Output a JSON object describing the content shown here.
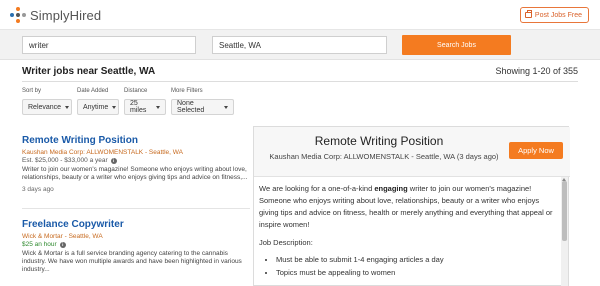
{
  "header": {
    "logo_text": "SimplyHired",
    "post_jobs_label": "Post Jobs Free",
    "brand_colors": [
      "#f47b20",
      "#2a6fb0",
      "#999999"
    ]
  },
  "search": {
    "what_value": "writer",
    "where_value": "Seattle, WA",
    "button_label": "Search Jobs"
  },
  "results": {
    "title": "Writer jobs near Seattle, WA",
    "showing": "Showing 1-20 of 355"
  },
  "filters": [
    {
      "label": "Sort by",
      "value": "Relevance"
    },
    {
      "label": "Date Added",
      "value": "Anytime"
    },
    {
      "label": "Distance",
      "value": "25 miles"
    },
    {
      "label": "More Filters",
      "value": "None Selected"
    }
  ],
  "jobs": [
    {
      "title": "Remote Writing Position",
      "company": "Kaushan Media Corp: ALLWOMENSTALK - Seattle, WA",
      "salary": "Est. $25,000 - $33,000 a year",
      "description": "Writer to join our women's magazine! Someone who enjoys writing about love, relationships, beauty or a writer who enjoys giving tips and advice on fitness,...",
      "age": "3 days ago"
    },
    {
      "title": "Freelance Copywriter",
      "company": "Wick & Mortar - Seattle, WA",
      "salary": "$25 an hour",
      "description": "Wick & Mortar is a full service branding agency catering to the cannabis industry. We have won multiple awards and have been highlighted in various industry...",
      "age": ""
    }
  ],
  "detail": {
    "title": "Remote Writing Position",
    "subtitle": "Kaushan Media Corp: ALLWOMENSTALK - Seattle, WA (3 days ago)",
    "apply_label": "Apply Now",
    "intro_before": "We are looking for a one-of-a-kind ",
    "intro_bold": "engaging",
    "intro_after": " writer to join our women's magazine! Someone who enjoys writing about love, relationships, beauty or a writer who enjoys giving tips and advice on fitness, health or merely anything and everything that appeal or inspire women!",
    "section_label": "Job Description:",
    "bullets": [
      "Must be able to submit 1-4 engaging articles a day",
      "Topics must be appealing to women"
    ]
  }
}
